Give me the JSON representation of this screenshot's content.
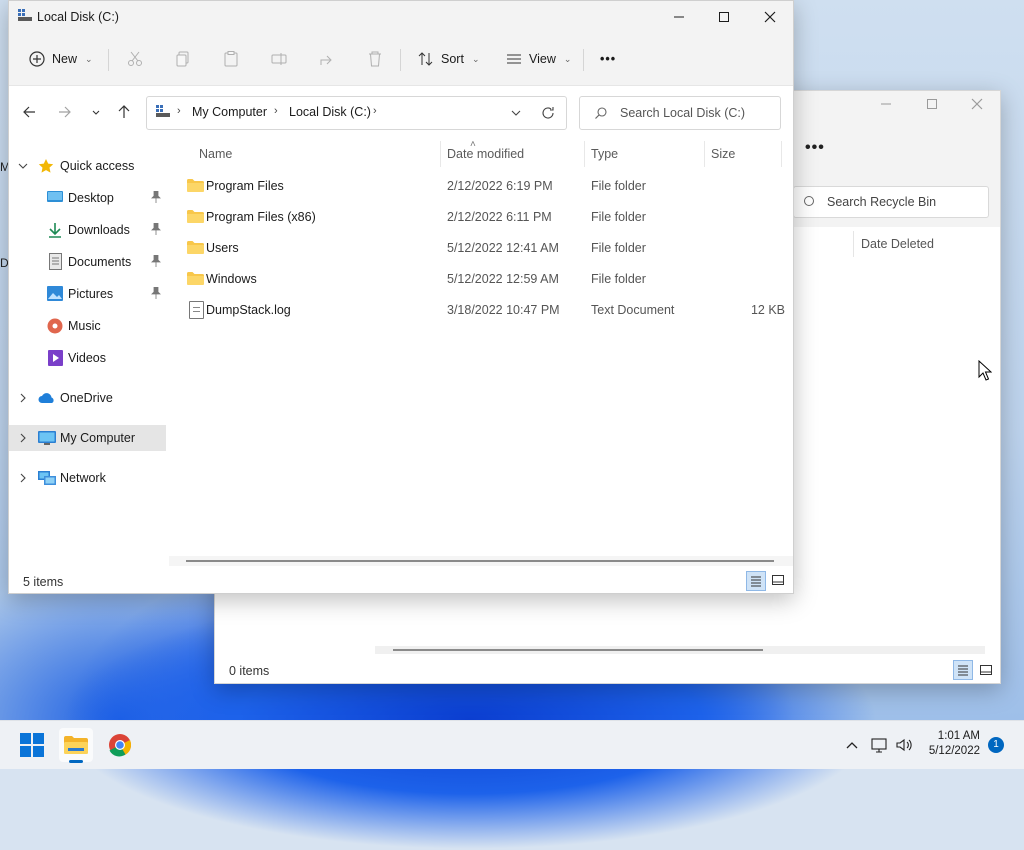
{
  "desktop": {
    "edge_letters": [
      "M",
      "D"
    ]
  },
  "recycle_window": {
    "more_label": "•••",
    "search_placeholder": "Search Recycle Bin",
    "column_date_deleted": "Date Deleted",
    "status": "0 items"
  },
  "explorer": {
    "title": "Local Disk (C:)",
    "toolbar": {
      "new_label": "New",
      "sort_label": "Sort",
      "view_label": "View",
      "more_label": "•••"
    },
    "address": {
      "segments": [
        "My Computer",
        "Local Disk (C:)"
      ]
    },
    "search_placeholder": "Search Local Disk (C:)",
    "sidebar": {
      "quick_access": "Quick access",
      "desktop": "Desktop",
      "downloads": "Downloads",
      "documents": "Documents",
      "pictures": "Pictures",
      "music": "Music",
      "videos": "Videos",
      "onedrive": "OneDrive",
      "my_computer": "My Computer",
      "network": "Network"
    },
    "columns": {
      "name": "Name",
      "date": "Date modified",
      "type": "Type",
      "size": "Size"
    },
    "files": [
      {
        "name": "Program Files",
        "date": "2/12/2022 6:19 PM",
        "type": "File folder",
        "size": ""
      },
      {
        "name": "Program Files (x86)",
        "date": "2/12/2022 6:11 PM",
        "type": "File folder",
        "size": ""
      },
      {
        "name": "Users",
        "date": "5/12/2022 12:41 AM",
        "type": "File folder",
        "size": ""
      },
      {
        "name": "Windows",
        "date": "5/12/2022 12:59 AM",
        "type": "File folder",
        "size": ""
      },
      {
        "name": "DumpStack.log",
        "date": "3/18/2022 10:47 PM",
        "type": "Text Document",
        "size": "12 KB"
      }
    ],
    "status": "5 items"
  },
  "taskbar": {
    "time": "1:01 AM",
    "date": "5/12/2022",
    "notification_count": "1"
  }
}
